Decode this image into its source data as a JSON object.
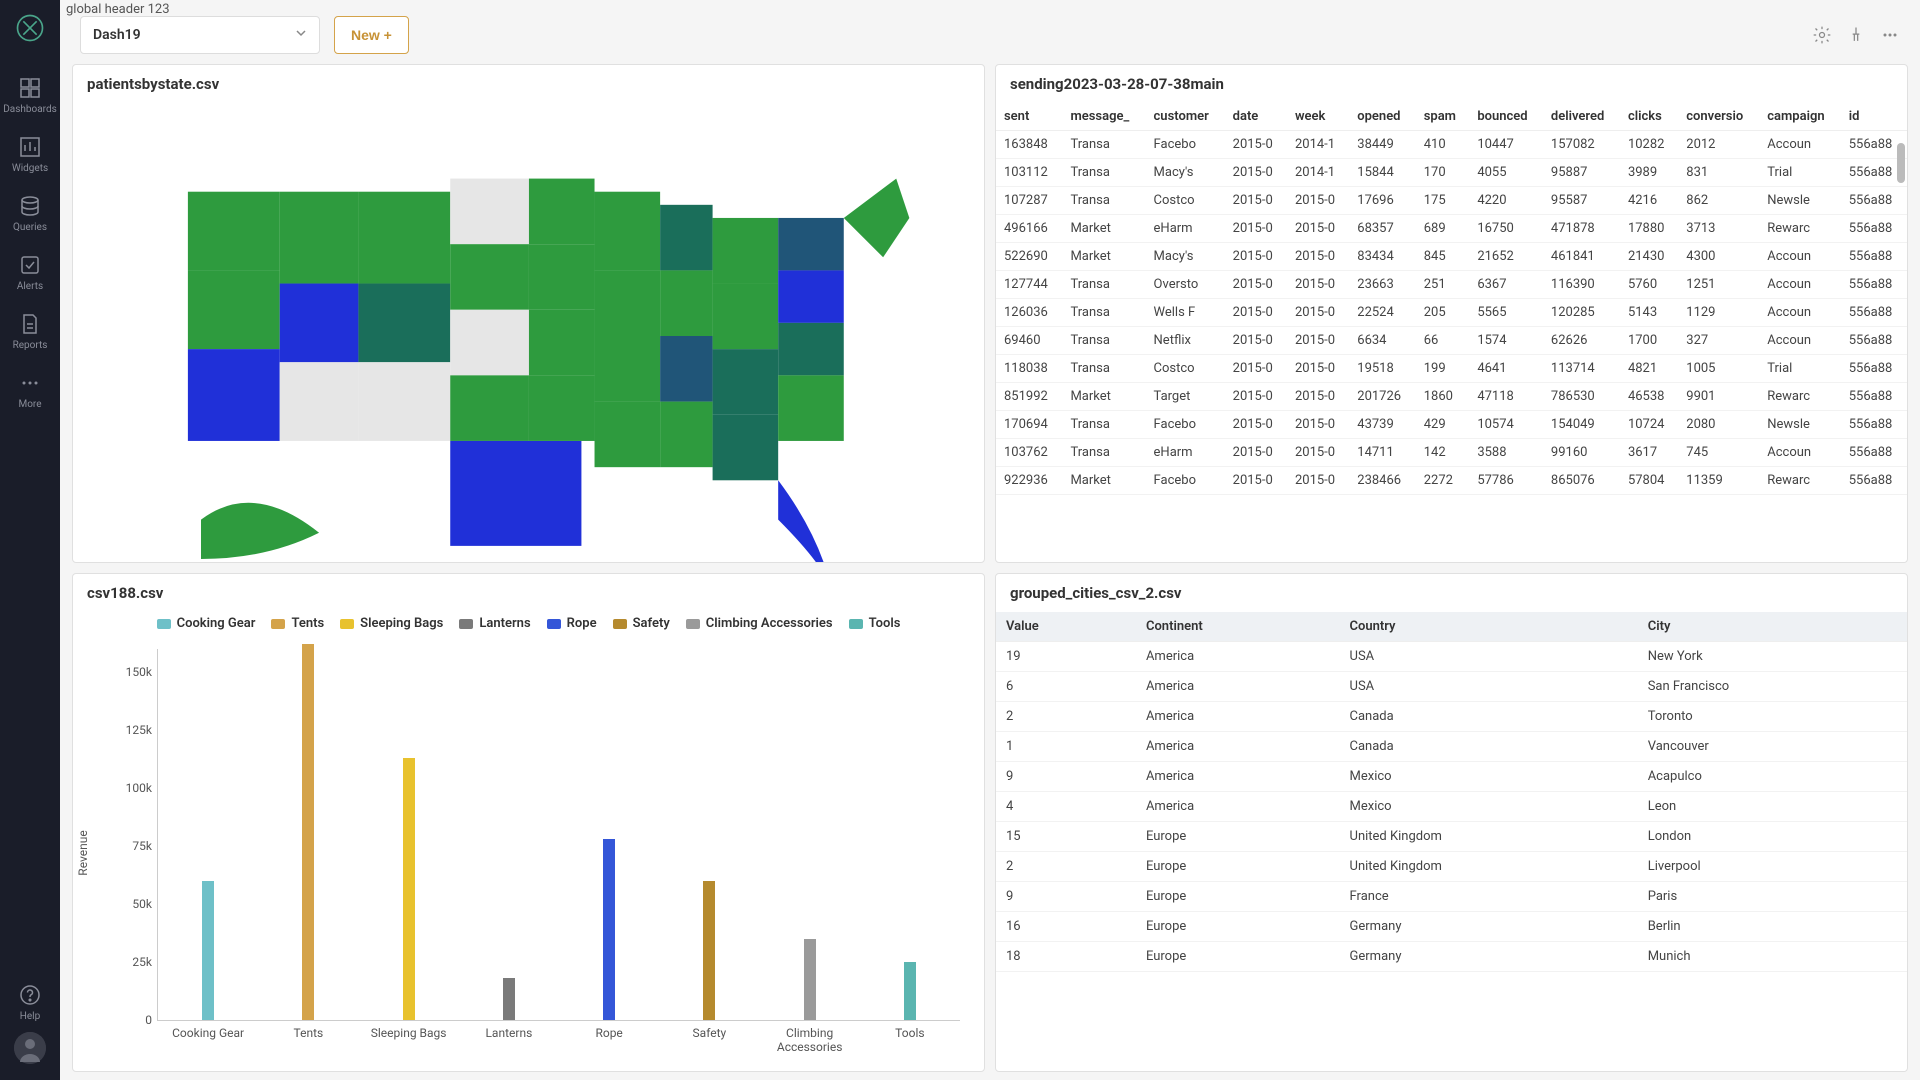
{
  "global_header": "global header 123",
  "sidebar": {
    "items": [
      {
        "label": "Dashboards"
      },
      {
        "label": "Widgets"
      },
      {
        "label": "Queries"
      },
      {
        "label": "Alerts"
      },
      {
        "label": "Reports"
      },
      {
        "label": "More"
      }
    ],
    "help": "Help"
  },
  "topbar": {
    "dash_name": "Dash19",
    "new_label": "New +"
  },
  "cards": {
    "map": {
      "title": "patientsbystate.csv",
      "min": "1",
      "max": "788"
    },
    "sending": {
      "title": "sending2023-03-28-07-38main",
      "columns": [
        "sent",
        "message_",
        "customer",
        "date",
        "week",
        "opened",
        "spam",
        "bounced",
        "delivered",
        "clicks",
        "conversio",
        "campaign",
        "id"
      ],
      "rows": [
        [
          "163848",
          "Transa",
          "Facebo",
          "2015-0",
          "2014-1",
          "38449",
          "410",
          "10447",
          "157082",
          "10282",
          "2012",
          "Accoun",
          "556a88"
        ],
        [
          "103112",
          "Transa",
          "Macy's",
          "2015-0",
          "2014-1",
          "15844",
          "170",
          "4055",
          "95887",
          "3989",
          "831",
          "Trial",
          "556a88"
        ],
        [
          "107287",
          "Transa",
          "Costco",
          "2015-0",
          "2015-0",
          "17696",
          "175",
          "4220",
          "95587",
          "4216",
          "862",
          "Newsle",
          "556a88"
        ],
        [
          "496166",
          "Market",
          "eHarm",
          "2015-0",
          "2015-0",
          "68357",
          "689",
          "16750",
          "471878",
          "17880",
          "3713",
          "Rewarc",
          "556a88"
        ],
        [
          "522690",
          "Market",
          "Macy's",
          "2015-0",
          "2015-0",
          "83434",
          "845",
          "21652",
          "461841",
          "21430",
          "4300",
          "Accoun",
          "556a88"
        ],
        [
          "127744",
          "Transa",
          "Oversto",
          "2015-0",
          "2015-0",
          "23663",
          "251",
          "6367",
          "116390",
          "5760",
          "1251",
          "Accoun",
          "556a88"
        ],
        [
          "126036",
          "Transa",
          "Wells F",
          "2015-0",
          "2015-0",
          "22524",
          "205",
          "5565",
          "120285",
          "5143",
          "1129",
          "Accoun",
          "556a88"
        ],
        [
          "69460",
          "Transa",
          "Netflix",
          "2015-0",
          "2015-0",
          "6634",
          "66",
          "1574",
          "62626",
          "1700",
          "327",
          "Accoun",
          "556a88"
        ],
        [
          "118038",
          "Transa",
          "Costco",
          "2015-0",
          "2015-0",
          "19518",
          "199",
          "4641",
          "113714",
          "4821",
          "1005",
          "Trial",
          "556a88"
        ],
        [
          "851992",
          "Market",
          "Target",
          "2015-0",
          "2015-0",
          "201726",
          "1860",
          "47118",
          "786530",
          "46538",
          "9901",
          "Rewarc",
          "556a88"
        ],
        [
          "170694",
          "Transa",
          "Facebo",
          "2015-0",
          "2015-0",
          "43739",
          "429",
          "10574",
          "154049",
          "10724",
          "2080",
          "Newsle",
          "556a88"
        ],
        [
          "103762",
          "Transa",
          "eHarm",
          "2015-0",
          "2015-0",
          "14711",
          "142",
          "3588",
          "99160",
          "3617",
          "745",
          "Accoun",
          "556a88"
        ],
        [
          "922936",
          "Market",
          "Facebo",
          "2015-0",
          "2015-0",
          "238466",
          "2272",
          "57786",
          "865076",
          "57804",
          "11359",
          "Rewarc",
          "556a88"
        ]
      ]
    },
    "bar": {
      "title": "csv188.csv",
      "ylabel": "Revenue"
    },
    "cities": {
      "title": "grouped_cities_csv_2.csv",
      "columns": [
        "Value",
        "Continent",
        "Country",
        "City"
      ],
      "rows": [
        [
          "19",
          "America",
          "USA",
          "New York"
        ],
        [
          "6",
          "America",
          "USA",
          "San Francisco"
        ],
        [
          "2",
          "America",
          "Canada",
          "Toronto"
        ],
        [
          "1",
          "America",
          "Canada",
          "Vancouver"
        ],
        [
          "9",
          "America",
          "Mexico",
          "Acapulco"
        ],
        [
          "4",
          "America",
          "Mexico",
          "Leon"
        ],
        [
          "15",
          "Europe",
          "United Kingdom",
          "London"
        ],
        [
          "2",
          "Europe",
          "United Kingdom",
          "Liverpool"
        ],
        [
          "9",
          "Europe",
          "France",
          "Paris"
        ],
        [
          "16",
          "Europe",
          "Germany",
          "Berlin"
        ],
        [
          "18",
          "Europe",
          "Germany",
          "Munich"
        ]
      ]
    }
  },
  "chart_data": {
    "type": "bar",
    "title": "csv188.csv",
    "ylabel": "Revenue",
    "ylim": [
      0,
      160000
    ],
    "yticks": [
      0,
      25000,
      50000,
      75000,
      100000,
      125000,
      150000
    ],
    "ytick_labels": [
      "0",
      "25k",
      "50k",
      "75k",
      "100k",
      "125k",
      "150k"
    ],
    "categories": [
      "Cooking Gear",
      "Tents",
      "Sleeping Bags",
      "Lanterns",
      "Rope",
      "Safety",
      "Climbing Accessories",
      "Tools"
    ],
    "series": [
      {
        "name": "Cooking Gear",
        "color": "#6ec0c8",
        "values": [
          60000,
          0,
          0,
          0,
          0,
          0,
          0,
          0
        ]
      },
      {
        "name": "Tents",
        "color": "#d4a34a",
        "values": [
          0,
          162000,
          0,
          0,
          0,
          0,
          0,
          0
        ]
      },
      {
        "name": "Sleeping Bags",
        "color": "#e8c22e",
        "values": [
          0,
          0,
          113000,
          0,
          0,
          0,
          0,
          0
        ]
      },
      {
        "name": "Lanterns",
        "color": "#7a7a7a",
        "values": [
          0,
          0,
          0,
          18000,
          0,
          0,
          0,
          0
        ]
      },
      {
        "name": "Rope",
        "color": "#3456d8",
        "values": [
          0,
          0,
          0,
          0,
          78000,
          0,
          0,
          0
        ]
      },
      {
        "name": "Safety",
        "color": "#b58a2e",
        "values": [
          0,
          0,
          0,
          0,
          0,
          60000,
          0,
          0
        ]
      },
      {
        "name": "Climbing Accessories",
        "color": "#9a9a9a",
        "values": [
          0,
          0,
          0,
          0,
          0,
          0,
          35000,
          0
        ]
      },
      {
        "name": "Tools",
        "color": "#5ab5b0",
        "values": [
          0,
          0,
          0,
          0,
          0,
          0,
          0,
          25000
        ]
      }
    ]
  }
}
